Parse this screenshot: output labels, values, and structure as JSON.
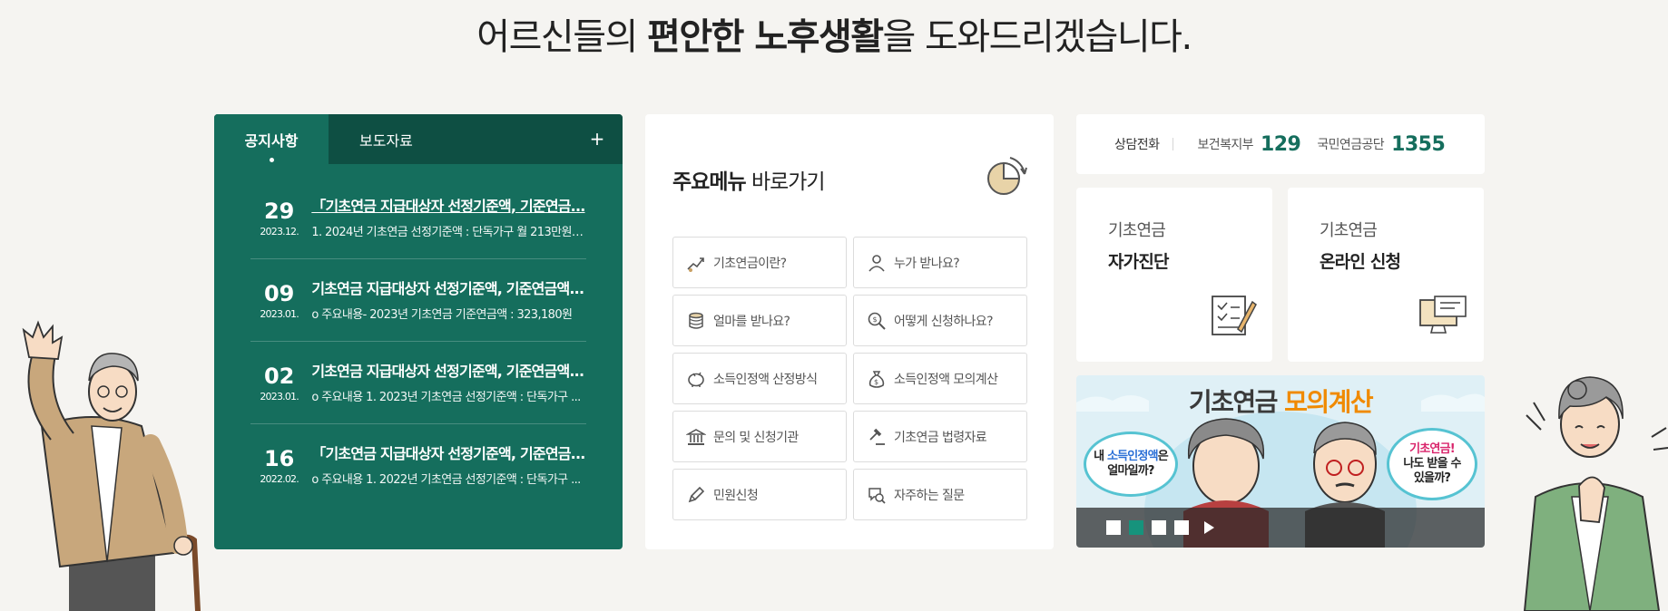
{
  "headline": {
    "pre": "어르신들의 ",
    "bold": "편안한 노후생활",
    "post": "을 도와드리겠습니다."
  },
  "notice": {
    "tabs": [
      {
        "label": "공지사항",
        "active": true
      },
      {
        "label": "보도자료",
        "active": false
      }
    ],
    "more_label": "+",
    "items": [
      {
        "day": "29",
        "ym": "2023.12.",
        "title": "「기초연금 지급대상자 선정기준액, 기준연금...",
        "desc": "1. 2024년 기초연금 선정기준액 : 단독가구 월 213만원 /..."
      },
      {
        "day": "09",
        "ym": "2023.01.",
        "title": "기초연금 지급대상자 선정기준액, 기준연금액...",
        "desc": "o 주요내용- 2023년 기초연금 기준연금액 : 323,180원"
      },
      {
        "day": "02",
        "ym": "2023.01.",
        "title": "기초연금 지급대상자 선정기준액, 기준연금액...",
        "desc": "o 주요내용 1. 2023년 기초연금 선정기준액 : 단독가구 ..."
      },
      {
        "day": "16",
        "ym": "2022.02.",
        "title": "「기초연금 지급대상자 선정기준액, 기준연금...",
        "desc": "o 주요내용 1. 2022년 기초연금 선정기준액 : 단독가구 ..."
      }
    ]
  },
  "menu": {
    "title_bold": "주요메뉴",
    "title_rest": " 바로가기",
    "items": [
      {
        "label": "기초연금이란?",
        "icon": "growth-chart-icon"
      },
      {
        "label": "누가 받나요?",
        "icon": "person-icon"
      },
      {
        "label": "얼마를 받나요?",
        "icon": "coins-icon"
      },
      {
        "label": "어떻게 신청하나요?",
        "icon": "search-money-icon"
      },
      {
        "label": "소득인정액 산정방식",
        "icon": "piggy-bank-icon"
      },
      {
        "label": "소득인정액 모의계산",
        "icon": "money-bag-icon"
      },
      {
        "label": "문의 및 신청기관",
        "icon": "building-icon"
      },
      {
        "label": "기초연금 법령자료",
        "icon": "gavel-icon"
      },
      {
        "label": "민원신청",
        "icon": "pen-icon"
      },
      {
        "label": "자주하는 질문",
        "icon": "chat-search-icon"
      }
    ]
  },
  "phone": {
    "label": "상담전화",
    "contacts": [
      {
        "org": "보건복지부",
        "number": "129"
      },
      {
        "org": "국민연금공단",
        "number": "1355"
      }
    ]
  },
  "cards": [
    {
      "line1": "기초연금",
      "line2": "자가진단",
      "icon": "checklist-icon"
    },
    {
      "line1": "기초연금",
      "line2": "온라인 신청",
      "icon": "computer-icon"
    }
  ],
  "banner": {
    "title_main": "기초연금 ",
    "title_accent": "모의계산",
    "bubble_left": {
      "pre": "내 ",
      "accent": "소득인정액",
      "post": "은",
      "line2": "얼마일까?"
    },
    "bubble_right": {
      "accent": "기초연금!",
      "line2": "나도 받을 수",
      "line3": "있을까?"
    },
    "slides": 4,
    "active_slide": 2
  },
  "colors": {
    "primary": "#156e5d",
    "primary_dark": "#0e4f43",
    "accent": "#f08a00",
    "background": "#f5f4f1"
  }
}
